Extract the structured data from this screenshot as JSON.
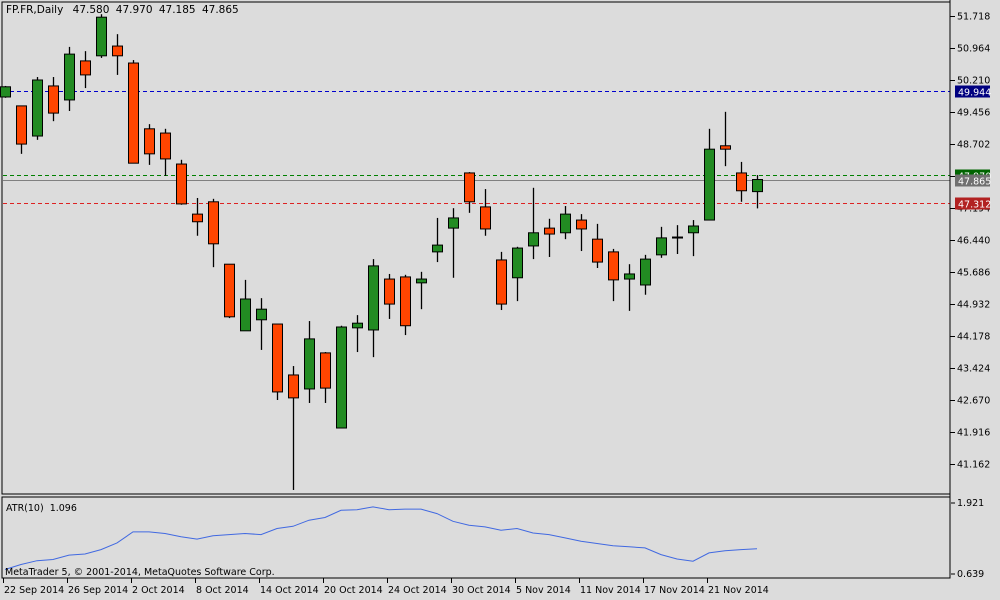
{
  "chart_data": {
    "type": "candlestick",
    "title": "FP.FR,Daily",
    "symbol": "FP.FR",
    "timeframe": "Daily",
    "header_values": [
      "47.580",
      "47.970",
      "47.185",
      "47.865"
    ],
    "ylim": [
      41.162,
      51.718
    ],
    "y_ticks": [
      "51.718",
      "50.964",
      "50.210",
      "49.456",
      "48.702",
      "47.948",
      "47.194",
      "46.440",
      "45.686",
      "44.932",
      "44.178",
      "43.424",
      "42.670",
      "41.916",
      "41.162"
    ],
    "x_tick_labels": [
      "22 Sep 2014",
      "26 Sep 2014",
      "2 Oct 2014",
      "8 Oct 2014",
      "14 Oct 2014",
      "20 Oct 2014",
      "24 Oct 2014",
      "30 Oct 2014",
      "5 Nov 2014",
      "11 Nov 2014",
      "17 Nov 2014",
      "21 Nov 2014"
    ],
    "x_tick_every": 4,
    "candles": [
      [
        49.81,
        50.07,
        49.79,
        50.05
      ],
      [
        49.6,
        49.6,
        48.47,
        48.7
      ],
      [
        48.89,
        50.28,
        48.8,
        50.21
      ],
      [
        50.07,
        50.28,
        49.24,
        49.43
      ],
      [
        49.74,
        50.99,
        49.48,
        50.82
      ],
      [
        50.66,
        50.89,
        50.02,
        50.33
      ],
      [
        50.78,
        51.76,
        50.73,
        51.69
      ],
      [
        51.01,
        51.29,
        50.33,
        50.78
      ],
      [
        50.61,
        50.68,
        48.25,
        48.25
      ],
      [
        49.06,
        49.17,
        48.21,
        48.47
      ],
      [
        48.96,
        49.06,
        47.95,
        48.35
      ],
      [
        48.23,
        48.33,
        47.27,
        47.29
      ],
      [
        47.05,
        47.43,
        46.54,
        46.87
      ],
      [
        47.34,
        47.41,
        45.8,
        46.35
      ],
      [
        45.87,
        45.87,
        44.6,
        44.63
      ],
      [
        44.3,
        45.5,
        44.3,
        45.05
      ],
      [
        44.56,
        45.07,
        43.85,
        44.81
      ],
      [
        44.46,
        44.46,
        42.67,
        42.86
      ],
      [
        43.26,
        43.47,
        40.55,
        42.72
      ],
      [
        42.93,
        44.53,
        42.6,
        44.11
      ],
      [
        43.78,
        43.8,
        42.6,
        42.95
      ],
      [
        42.01,
        44.42,
        42.01,
        44.39
      ],
      [
        44.37,
        44.67,
        43.8,
        44.48
      ],
      [
        44.32,
        45.99,
        43.68,
        45.83
      ],
      [
        45.52,
        45.64,
        44.58,
        44.93
      ],
      [
        45.57,
        45.62,
        44.2,
        44.42
      ],
      [
        45.43,
        45.69,
        44.81,
        45.52
      ],
      [
        46.16,
        46.96,
        45.92,
        46.32
      ],
      [
        46.72,
        47.19,
        45.55,
        46.96
      ],
      [
        48.02,
        48.04,
        47.08,
        47.34
      ],
      [
        47.22,
        47.64,
        46.54,
        46.7
      ],
      [
        45.97,
        46.16,
        44.79,
        44.93
      ],
      [
        45.55,
        46.28,
        45.0,
        46.25
      ],
      [
        46.3,
        47.67,
        45.99,
        46.61
      ],
      [
        46.72,
        46.94,
        46.04,
        46.58
      ],
      [
        46.61,
        47.24,
        46.46,
        47.05
      ],
      [
        46.91,
        47.05,
        46.18,
        46.7
      ],
      [
        46.46,
        46.82,
        45.78,
        45.92
      ],
      [
        46.16,
        46.23,
        45.0,
        45.5
      ],
      [
        45.52,
        45.87,
        44.77,
        45.64
      ],
      [
        45.38,
        46.09,
        45.15,
        45.99
      ],
      [
        46.09,
        46.75,
        46.02,
        46.49
      ],
      [
        46.51,
        46.79,
        46.11,
        46.49
      ],
      [
        46.61,
        46.91,
        46.06,
        46.77
      ],
      [
        46.91,
        49.06,
        46.91,
        48.58
      ],
      [
        48.66,
        49.46,
        48.18,
        48.58
      ],
      [
        48.02,
        48.28,
        47.34,
        47.6
      ],
      [
        47.58,
        47.97,
        47.185,
        47.865
      ]
    ],
    "levels": [
      {
        "name": "blue-level",
        "value": "49.944",
        "color": "#0000cd",
        "label_bg": "#000080"
      },
      {
        "name": "ask-level",
        "value": "47.970",
        "color": "#008000",
        "label_bg": "#006400"
      },
      {
        "name": "last-price",
        "value": "47.865",
        "color": "#808080",
        "label_bg": "#707070"
      },
      {
        "name": "red-level",
        "value": "47.312",
        "color": "#dd2222",
        "label_bg": "#b22222"
      }
    ],
    "colors": {
      "bull": "#228b22",
      "bear": "#ff4500",
      "background": "#dcdcdc",
      "atr": "#4169e1"
    },
    "indicator": {
      "name": "ATR(10)",
      "value_text": "1.096",
      "ylim": [
        0.639,
        1.921
      ],
      "y_ticks": [
        "1.921",
        "0.639"
      ],
      "values": [
        0.72,
        0.81,
        0.88,
        0.9,
        0.98,
        1.0,
        1.08,
        1.2,
        1.4,
        1.4,
        1.37,
        1.31,
        1.27,
        1.33,
        1.35,
        1.37,
        1.35,
        1.46,
        1.5,
        1.61,
        1.66,
        1.79,
        1.8,
        1.85,
        1.8,
        1.81,
        1.81,
        1.73,
        1.59,
        1.52,
        1.49,
        1.43,
        1.46,
        1.38,
        1.35,
        1.29,
        1.23,
        1.19,
        1.15,
        1.13,
        1.11,
        0.99,
        0.91,
        0.87,
        1.02,
        1.06,
        1.08,
        1.096
      ]
    }
  },
  "footer": {
    "copyright": "MetaTrader 5, © 2001-2014, MetaQuotes Software Corp."
  }
}
